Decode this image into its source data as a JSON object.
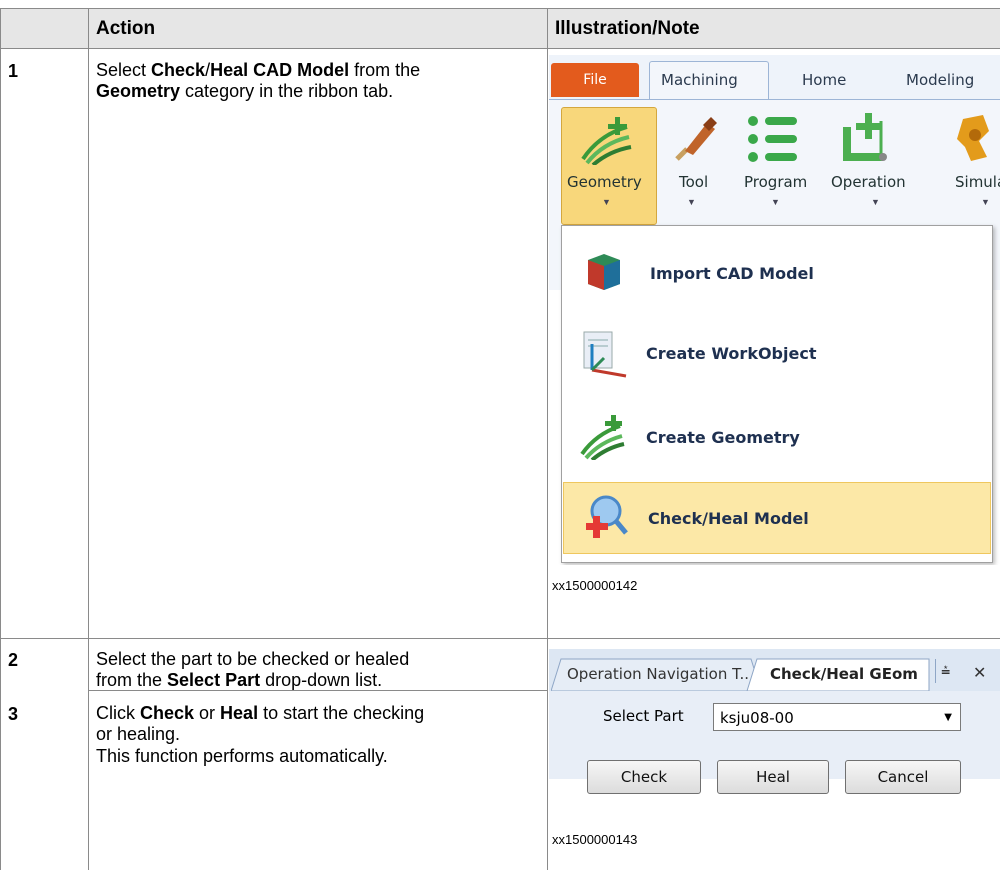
{
  "table": {
    "headers": {
      "num": "",
      "action": "Action",
      "note": "Illustration/Note"
    },
    "rows": [
      {
        "num": "1",
        "action_line1_pre": "Select ",
        "action_line1_b1": "Check",
        "action_line1_mid": "/",
        "action_line1_b2": "Heal CAD Model",
        "action_line1_post": " from the",
        "action_line2_b": "Geometry",
        "action_line2_post": " category in the ribbon tab.",
        "caption": "xx1500000142"
      },
      {
        "num": "2",
        "action_line1": "Select the part to be checked or healed",
        "action_line2_pre": "from the ",
        "action_line2_b": "Select Part",
        "action_line2_post": " drop-down list."
      },
      {
        "num": "3",
        "action_line1_pre": "Click ",
        "action_line1_b1": "Check",
        "action_line1_mid": " or ",
        "action_line1_b2": "Heal",
        "action_line1_post": " to start the checking",
        "action_line2": "or healing.",
        "action_line3": "This function performs automatically.",
        "caption": "xx1500000143"
      }
    ]
  },
  "ribbon": {
    "tabs": [
      "File",
      "Machining",
      "Home",
      "Modeling"
    ],
    "buttons": [
      "Geometry",
      "Tool",
      "Program",
      "Operation",
      "Simula"
    ],
    "menu": [
      "Import CAD Model",
      "Create WorkObject",
      "Create Geometry",
      "Check/Heal Model"
    ],
    "icons": [
      "geometry-icon",
      "tool-icon",
      "program-icon",
      "operation-icon",
      "simulation-icon",
      "import-cad-icon",
      "workobject-icon",
      "create-geometry-icon",
      "check-heal-icon"
    ]
  },
  "panel": {
    "tabs": [
      "Operation Navigation T..",
      "Check/Heal GEom"
    ],
    "pin_glyph": "⩮",
    "close_glyph": "✕",
    "select_label": "Select Part",
    "select_value": "ksju08-00",
    "buttons": [
      "Check",
      "Heal",
      "Cancel"
    ]
  },
  "colors": {
    "header_bg": "#e6e6e6",
    "file_tab": "#e35b1d",
    "highlight": "#fce8a7",
    "ribbon_bg": "#f3f6fb"
  }
}
